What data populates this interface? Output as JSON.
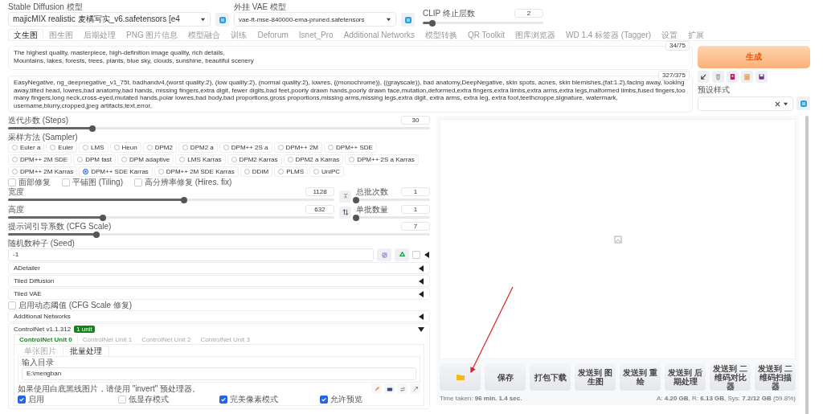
{
  "top_bar": {
    "model": {
      "label": "Stable Diffusion 模型",
      "value": "majicMIX realistic 麦橘写实_v6.safetensors [e4"
    },
    "vae": {
      "label": "外挂 VAE 模型",
      "value": "vae-ft-mse-840000-ema-pruned.safetensors"
    },
    "clip": {
      "label": "CLIP 终止层数",
      "value": "2",
      "level": 0.08
    }
  },
  "tabs": [
    {
      "label": "文生图",
      "selected": true
    },
    {
      "label": "图生图",
      "selected": false
    },
    {
      "label": "后期处理",
      "selected": false
    },
    {
      "label": "PNG 图片信息",
      "selected": false
    },
    {
      "label": "模型融合",
      "selected": false
    },
    {
      "label": "训练",
      "selected": false
    },
    {
      "label": "Deforum",
      "selected": false
    },
    {
      "label": "Isnet_Pro",
      "selected": false
    },
    {
      "label": "Additional Networks",
      "selected": false
    },
    {
      "label": "模型转换",
      "selected": false
    },
    {
      "label": "QR Toolkit",
      "selected": false
    },
    {
      "label": "图库浏览器",
      "selected": false
    },
    {
      "label": "WD 1.4 标签器 (Tagger)",
      "selected": false
    },
    {
      "label": "设置",
      "selected": false
    },
    {
      "label": "扩展",
      "selected": false
    }
  ],
  "prompt": {
    "lines": [
      "The highest quality, masterpiece, high-definition image quality, rich details,",
      "Mountains, lakes, forests, trees, plants, blue sky, clouds, sunshine, beautiful scenery"
    ],
    "counter": "34/75"
  },
  "negative_prompt": {
    "text": "EasyNegative, ng_deepnegative_v1_75t, badhandv4,(worst quality:2), (low quality:2), (normal quality:2), lowres, ((monochrome)), ((grayscale)), bad anatomy,DeepNegative, skin spots, acnes, skin blemishes,(fat:1.2),facing away, looking away,tilted head, lowres,bad anatomy,bad hands, missing fingers,extra digit, fewer digits,bad feet,poorly drawn hands,poorly drawn face,mutation,deformed,extra fingers,extra limbs,extra arms,extra legs,malformed limbs,fused fingers,too many fingers,long neck,cross-eyed,mutated hands,polar lowres,bad body,bad proportions,gross proportions,missing arms,missing legs,extra digit, extra arms, extra leg, extra foot,teethcroppe,signature, watermark, username,blurry,cropped,jpeg artifacts,text,error,",
    "counter": "327/375"
  },
  "generate_button": "生成",
  "styles": {
    "label": "预设样式"
  },
  "steps": {
    "label": "迭代步数 (Steps)",
    "value": "30",
    "level": 0.2
  },
  "sampler": {
    "label": "采样方法 (Sampler)",
    "options": [
      {
        "label": "Euler a",
        "selected": false
      },
      {
        "label": "Euler",
        "selected": false
      },
      {
        "label": "LMS",
        "selected": false
      },
      {
        "label": "Heun",
        "selected": false
      },
      {
        "label": "DPM2",
        "selected": false
      },
      {
        "label": "DPM2 a",
        "selected": false
      },
      {
        "label": "DPM++ 2S a",
        "selected": false
      },
      {
        "label": "DPM++ 2M",
        "selected": false
      },
      {
        "label": "DPM++ SDE",
        "selected": false
      },
      {
        "label": "DPM++ 2M SDE",
        "selected": false
      },
      {
        "label": "DPM fast",
        "selected": false
      },
      {
        "label": "DPM adaptive",
        "selected": false
      },
      {
        "label": "LMS Karras",
        "selected": false
      },
      {
        "label": "DPM2 Karras",
        "selected": false
      },
      {
        "label": "DPM2 a Karras",
        "selected": false
      },
      {
        "label": "DPM++ 2S a Karras",
        "selected": false
      },
      {
        "label": "DPM++ 2M Karras",
        "selected": false
      },
      {
        "label": "DPM++ SDE Karras",
        "selected": true
      },
      {
        "label": "DPM++ 2M SDE Karras",
        "selected": false
      },
      {
        "label": "DDIM",
        "selected": false
      },
      {
        "label": "PLMS",
        "selected": false
      },
      {
        "label": "UniPC",
        "selected": false
      }
    ]
  },
  "options": [
    {
      "label": "面部修复",
      "checked": false
    },
    {
      "label": "平铺图 (Tiling)",
      "checked": false
    },
    {
      "label": "高分辨率修复 (Hires. fix)",
      "checked": false
    }
  ],
  "width": {
    "label": "宽度",
    "value": "1128",
    "level": 0.54
  },
  "height": {
    "label": "高度",
    "value": "632",
    "level": 0.29
  },
  "batch_count": {
    "label": "总批次数",
    "value": "1",
    "level": 0
  },
  "batch_size": {
    "label": "单批数量",
    "value": "1",
    "level": 0
  },
  "cfg_scale": {
    "label": "提示词引导系数 (CFG Scale)",
    "value": "7",
    "level": 0.21
  },
  "seed": {
    "label": "随机数种子 (Seed)",
    "value": "-1",
    "extra_checked": false
  },
  "accordions": [
    {
      "title": "ADetailer",
      "expanded": false
    },
    {
      "title": "Tiled Diffusion",
      "expanded": false
    },
    {
      "title": "Tiled VAE",
      "expanded": false
    }
  ],
  "dynamic_threshold": {
    "label": "启用动态阈值 (CFG Scale 修复)",
    "checked": false
  },
  "additional_networks": {
    "title": "Additional Networks",
    "expanded": false
  },
  "controlnet": {
    "title": "ControlNet v1.1.312",
    "badge": "1 unit",
    "expanded": true,
    "units": [
      {
        "label": "ControlNet Unit 0",
        "selected": true
      },
      {
        "label": "ControlNet Unit 1",
        "selected": false
      },
      {
        "label": "ControlNet Unit 2",
        "selected": false
      },
      {
        "label": "ControlNet Unit 3",
        "selected": false
      }
    ],
    "modes": [
      {
        "label": "单张图片",
        "selected": false
      },
      {
        "label": "批量处理",
        "selected": true
      }
    ],
    "input_dir": {
      "label": "输入目录",
      "value": "E:\\mengban"
    },
    "hint": "如果使用白底黑线图片，请使用 \"invert\" 预处理器。",
    "checkboxes": [
      {
        "label": "启用",
        "checked": true
      },
      {
        "label": "低显存模式",
        "checked": false
      },
      {
        "label": "完美像素模式",
        "checked": true
      },
      {
        "label": "允许预览",
        "checked": true
      }
    ]
  },
  "gallery": {
    "buttons": [
      {
        "kind": "folder"
      },
      {
        "kind": "text",
        "label": "保存"
      },
      {
        "kind": "text",
        "label": "打包下载"
      },
      {
        "kind": "text",
        "label": "发送到 图生图"
      },
      {
        "kind": "text",
        "label": "发送到 重绘"
      },
      {
        "kind": "text",
        "label": "发送到 后期处理"
      },
      {
        "kind": "text",
        "label": "发送到 二维码对比器"
      },
      {
        "kind": "text",
        "label": "发送到 二维码扫描器"
      }
    ],
    "time_taken": "Time taken: **96 min. 1.4 sec.**",
    "memory": "A: **4.20 GB**, R: **6.13 GB**, Sys: **7.2/12 GB** (59.8%)"
  }
}
